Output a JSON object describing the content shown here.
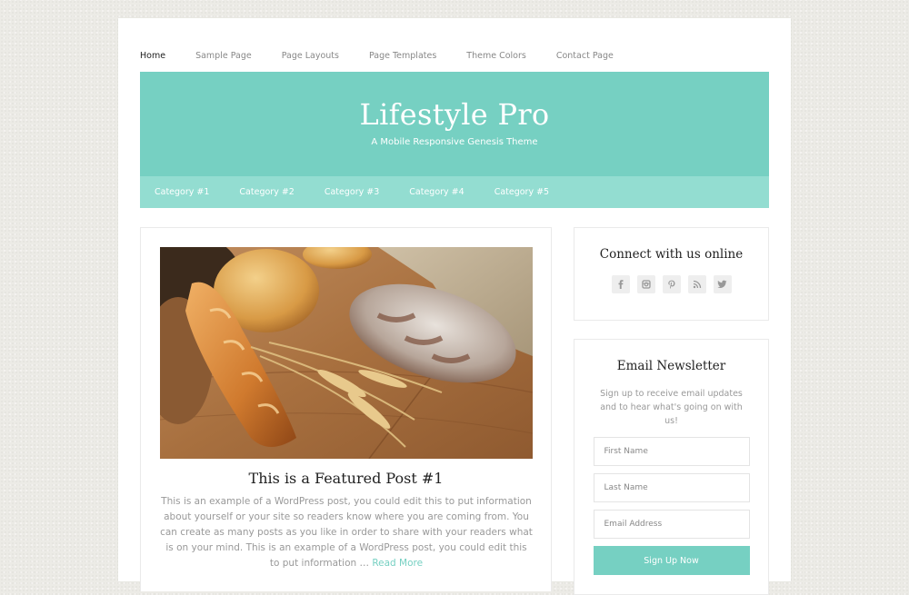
{
  "top_nav": [
    "Home",
    "Sample Page",
    "Page Layouts",
    "Page Templates",
    "Theme Colors",
    "Contact Page"
  ],
  "header": {
    "title": "Lifestyle Pro",
    "description": "A Mobile Responsive Genesis Theme"
  },
  "category_nav": [
    "Category #1",
    "Category #2",
    "Category #3",
    "Category #4",
    "Category #5"
  ],
  "post": {
    "title": "This is a Featured Post #1",
    "excerpt": "This is an example of a WordPress post, you could edit this to put information about yourself or your site so readers know where you are coming from. You can create as many posts as you like in order to share with your readers what is on your mind. This is an example of a WordPress post, you could edit this to put information … ",
    "read_more": "Read More"
  },
  "connect_widget": {
    "title": "Connect with us online",
    "icons": [
      "facebook-icon",
      "instagram-icon",
      "pinterest-icon",
      "rss-icon",
      "twitter-icon"
    ]
  },
  "newsletter": {
    "title": "Email Newsletter",
    "text": "Sign up to receive email updates and to hear what's going on with us!",
    "first_name_placeholder": "First Name",
    "last_name_placeholder": "Last Name",
    "email_placeholder": "Email Address",
    "button": "Sign Up Now"
  },
  "colors": {
    "accent": "#76d0c2",
    "accent_light": "#93ddd1",
    "icon": "#999999"
  }
}
